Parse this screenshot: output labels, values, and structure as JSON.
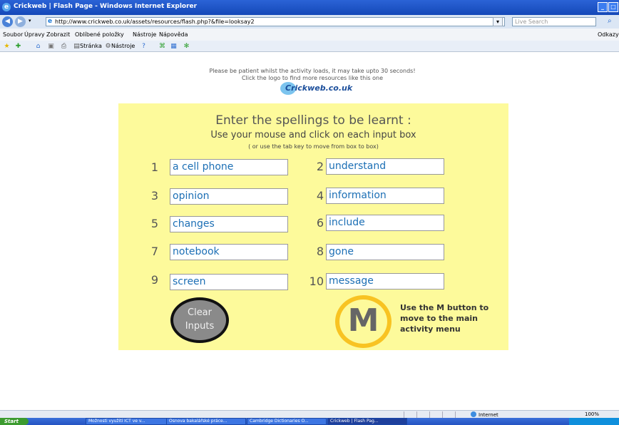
{
  "window": {
    "title": "Crickweb | Flash Page - Windows Internet Explorer"
  },
  "address": {
    "url": "http://www.crickweb.co.uk/assets/resources/flash.php?&file=looksay2",
    "search_placeholder": "Live Search"
  },
  "menu": {
    "items": [
      "Soubor",
      "Úpravy",
      "Zobrazit",
      "Oblíbené položky",
      "Nástroje",
      "Nápověda"
    ],
    "right": "Odkazy"
  },
  "favbar": {
    "page": "Stránka",
    "tools": "Nástroje"
  },
  "notice": {
    "line1": "Please be patient whilst the activity loads, it may take upto 30 seconds!",
    "line2": "Click the logo to find more resources like this one"
  },
  "logo": {
    "text": "Crickweb.co.uk"
  },
  "panel": {
    "heading": "Enter the spellings to be learnt :",
    "subheading": "Use your mouse and click on each input box",
    "hint": "( or use the tab key to move from box to box)",
    "spellings": [
      {
        "num": "1",
        "value": "a cell phone"
      },
      {
        "num": "2",
        "value": "understand"
      },
      {
        "num": "3",
        "value": "opinion"
      },
      {
        "num": "4",
        "value": "information"
      },
      {
        "num": "5",
        "value": "changes"
      },
      {
        "num": "6",
        "value": "include"
      },
      {
        "num": "7",
        "value": "notebook"
      },
      {
        "num": "8",
        "value": "gone"
      },
      {
        "num": "9",
        "value": "screen"
      },
      {
        "num": "10",
        "value": "message"
      }
    ],
    "clear_line1": "Clear",
    "clear_line2": "Inputs",
    "m_label": "M",
    "m_help": "Use the M button to move to the main activity menu"
  },
  "status": {
    "zone": "Internet",
    "zoom": "100%"
  },
  "taskbar": {
    "start": "Start",
    "tasks": [
      "Možnosti využití ICT ve v...",
      "Osnova bakalářské práce...",
      "Cambridge Dictionaries O...",
      "Crickweb | Flash Pag..."
    ]
  },
  "colors": {
    "panel": "#fdfa9b",
    "input_text": "#1c6fb5",
    "m_ring": "#f8c322"
  }
}
